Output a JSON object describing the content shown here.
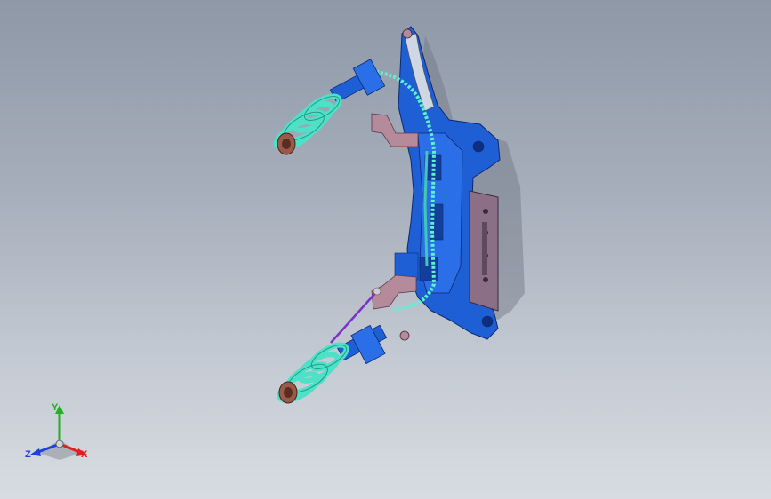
{
  "viewport": {
    "background_top": "#8e98a6",
    "background_bottom": "#d8dce2"
  },
  "model": {
    "colors": {
      "subframe": "#1f5fd6",
      "subframe_dark": "#123e9c",
      "spring": "#4fe0c8",
      "spring_dark": "#1f9c8a",
      "hose": "#5ef0d0",
      "bracket": "#b58a9a",
      "plate": "#8b6f86",
      "hub": "#9a5a4a",
      "link": "#7b32c8"
    }
  },
  "triad": {
    "y_label": "Y",
    "x_label": "X",
    "z_label": "Z",
    "colors": {
      "x": "#e02020",
      "y": "#20b020",
      "z": "#2040e0"
    }
  }
}
